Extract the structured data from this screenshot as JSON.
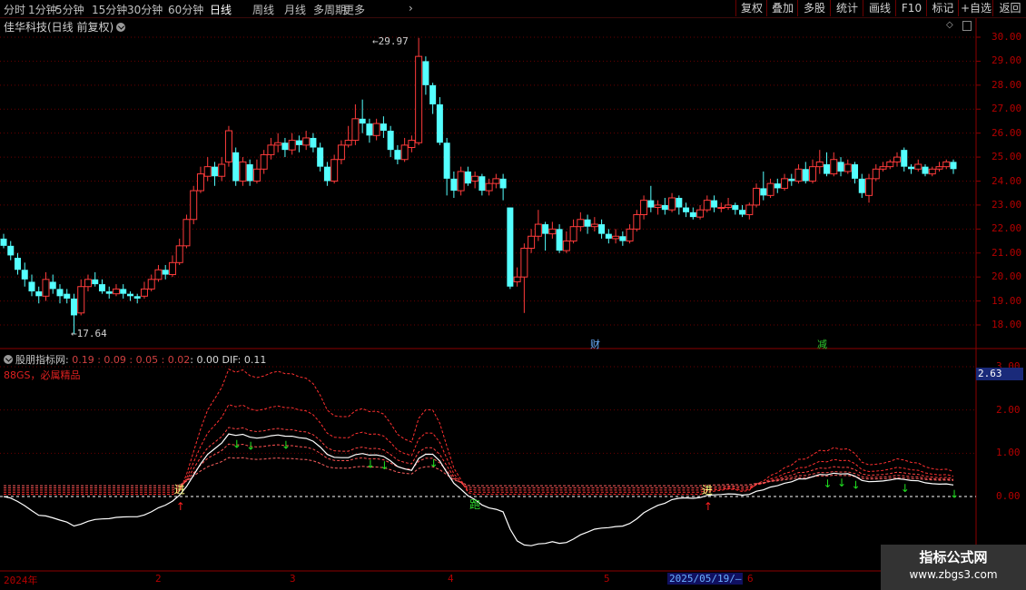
{
  "toolbar": {
    "periods": [
      "分时",
      "1分钟",
      "5分钟",
      "15分钟",
      "30分钟",
      "60分钟",
      "日线",
      "周线",
      "月线",
      "多周期",
      "更多"
    ],
    "active_period": "日线",
    "more_arrow": "›",
    "buttons": [
      "复权",
      "叠加",
      "多股",
      "统计",
      "画线",
      "F10",
      "标记",
      "+自选",
      "返回"
    ]
  },
  "main_chart": {
    "title": "佳华科技(日线 前复权)",
    "high_label": "29.97",
    "low_label": "17.64",
    "markers": {
      "cai": "财",
      "jian": "减"
    },
    "y_ticks": [
      "30.00",
      "29.00",
      "28.00",
      "27.00",
      "26.00",
      "25.00",
      "24.00",
      "23.00",
      "22.00",
      "21.00",
      "20.00",
      "19.00",
      "18.00"
    ]
  },
  "indicator": {
    "name": "股朋指标网",
    "values_prefix": ": ",
    "values": "0.19 : 0.09 : 0.05 : 0.02",
    "extra": ": 0.00  DIF: 0.11",
    "subtitle": "88GS，必属精品",
    "y_ticks": [
      "3.00",
      "2.00",
      "1.00",
      "0.00"
    ],
    "current_value": "2.63",
    "buy_label": "进",
    "run_label": "跑"
  },
  "time_axis": {
    "labels": [
      "2024年",
      "2",
      "3",
      "4",
      "5",
      "6"
    ],
    "cursor_date": "2025/05/19/—"
  },
  "watermark": {
    "line1": "指标公式网",
    "line2": "www.zbgs3.com"
  },
  "colors": {
    "up": "#ff3b3b",
    "down": "#54ffff",
    "grid": "#8b0000",
    "axis_text": "#b40000",
    "white_line": "#ffffff"
  },
  "chart_data": {
    "type": "candlestick",
    "ylim": [
      17.5,
      30.3
    ],
    "candles": [
      [
        21.6,
        21.3,
        21.8,
        21.2
      ],
      [
        21.3,
        20.9,
        21.5,
        20.7
      ],
      [
        20.8,
        20.3,
        21.0,
        20.1
      ],
      [
        20.3,
        19.9,
        20.6,
        19.6
      ],
      [
        19.8,
        19.4,
        20.1,
        19.2
      ],
      [
        19.4,
        19.2,
        19.6,
        18.9
      ],
      [
        19.2,
        19.9,
        20.2,
        19.0
      ],
      [
        19.8,
        19.5,
        20.1,
        19.3
      ],
      [
        19.5,
        19.2,
        19.7,
        18.9
      ],
      [
        19.3,
        19.1,
        19.5,
        18.9
      ],
      [
        19.1,
        18.4,
        19.3,
        17.64
      ],
      [
        18.5,
        19.6,
        19.9,
        18.4
      ],
      [
        19.6,
        19.9,
        20.1,
        19.4
      ],
      [
        19.9,
        19.7,
        20.2,
        19.6
      ],
      [
        19.7,
        19.4,
        19.9,
        19.3
      ],
      [
        19.4,
        19.3,
        19.6,
        19.1
      ],
      [
        19.3,
        19.5,
        19.7,
        19.2
      ],
      [
        19.5,
        19.3,
        19.7,
        19.1
      ],
      [
        19.3,
        19.2,
        19.4,
        19.0
      ],
      [
        19.2,
        19.1,
        19.3,
        18.9
      ],
      [
        19.2,
        19.5,
        19.8,
        19.1
      ],
      [
        19.5,
        19.9,
        20.1,
        19.4
      ],
      [
        19.9,
        20.3,
        20.5,
        19.8
      ],
      [
        20.3,
        20.1,
        20.5,
        19.9
      ],
      [
        20.1,
        20.6,
        20.9,
        20.0
      ],
      [
        20.6,
        21.3,
        21.6,
        20.5
      ],
      [
        21.3,
        22.4,
        22.6,
        21.2
      ],
      [
        22.4,
        23.6,
        23.8,
        22.2
      ],
      [
        23.6,
        24.3,
        24.6,
        23.5
      ],
      [
        24.2,
        24.6,
        25.0,
        24.0
      ],
      [
        24.6,
        24.2,
        24.8,
        23.8
      ],
      [
        24.2,
        24.7,
        25.0,
        24.0
      ],
      [
        24.8,
        26.1,
        26.3,
        24.6
      ],
      [
        25.2,
        24.0,
        25.4,
        23.8
      ],
      [
        24.0,
        24.8,
        25.0,
        23.8
      ],
      [
        24.7,
        24.0,
        24.9,
        23.8
      ],
      [
        24.0,
        24.5,
        24.9,
        23.9
      ],
      [
        24.5,
        25.1,
        25.3,
        24.3
      ],
      [
        25.1,
        25.5,
        25.8,
        24.9
      ],
      [
        25.5,
        25.6,
        26.0,
        25.2
      ],
      [
        25.6,
        25.3,
        25.8,
        25.0
      ],
      [
        25.3,
        25.7,
        26.0,
        25.1
      ],
      [
        25.7,
        25.5,
        25.9,
        25.2
      ],
      [
        25.5,
        25.8,
        26.1,
        25.3
      ],
      [
        25.8,
        25.4,
        26.0,
        25.2
      ],
      [
        25.4,
        24.6,
        25.6,
        24.4
      ],
      [
        24.6,
        24.0,
        24.8,
        23.8
      ],
      [
        24.0,
        24.9,
        25.1,
        23.9
      ],
      [
        24.9,
        25.5,
        25.7,
        24.7
      ],
      [
        25.5,
        25.7,
        26.3,
        25.4
      ],
      [
        25.7,
        26.6,
        27.2,
        25.5
      ],
      [
        26.6,
        26.4,
        27.4,
        26.0
      ],
      [
        26.4,
        25.9,
        26.6,
        25.6
      ],
      [
        25.9,
        26.4,
        26.6,
        25.7
      ],
      [
        26.4,
        26.1,
        26.7,
        25.8
      ],
      [
        26.1,
        25.3,
        26.3,
        25.0
      ],
      [
        25.3,
        24.9,
        25.5,
        24.7
      ],
      [
        24.9,
        25.5,
        25.8,
        24.8
      ],
      [
        25.4,
        25.7,
        25.9,
        25.2
      ],
      [
        25.6,
        29.2,
        29.97,
        25.5
      ],
      [
        29.0,
        28.0,
        29.2,
        27.6
      ],
      [
        28.0,
        27.2,
        28.1,
        26.8
      ],
      [
        27.2,
        25.6,
        27.5,
        25.5
      ],
      [
        25.6,
        24.1,
        25.8,
        23.4
      ],
      [
        24.1,
        23.6,
        24.4,
        23.3
      ],
      [
        23.6,
        24.4,
        24.6,
        23.4
      ],
      [
        24.4,
        23.9,
        24.6,
        23.8
      ],
      [
        24.0,
        24.2,
        24.4,
        23.7
      ],
      [
        24.2,
        23.6,
        24.3,
        23.4
      ],
      [
        23.6,
        23.9,
        24.1,
        23.4
      ],
      [
        23.9,
        24.1,
        24.3,
        23.7
      ],
      [
        24.1,
        23.7,
        24.3,
        23.2
      ],
      [
        22.9,
        19.6,
        22.9,
        19.5
      ],
      [
        19.8,
        20.0,
        20.4,
        19.6
      ],
      [
        20.0,
        21.2,
        21.4,
        18.5
      ],
      [
        21.2,
        21.7,
        22.0,
        21.0
      ],
      [
        21.7,
        22.2,
        22.8,
        21.5
      ],
      [
        22.2,
        21.8,
        22.3,
        21.1
      ],
      [
        21.8,
        22.0,
        22.3,
        21.6
      ],
      [
        22.0,
        21.1,
        22.2,
        21.0
      ],
      [
        21.1,
        21.5,
        21.9,
        21.0
      ],
      [
        21.5,
        22.1,
        22.4,
        21.4
      ],
      [
        22.1,
        22.4,
        22.7,
        21.9
      ],
      [
        22.4,
        22.1,
        22.6,
        21.8
      ],
      [
        22.1,
        22.2,
        22.5,
        21.9
      ],
      [
        22.2,
        21.8,
        22.4,
        21.6
      ],
      [
        21.8,
        21.6,
        22.0,
        21.4
      ],
      [
        21.6,
        21.7,
        22.0,
        21.4
      ],
      [
        21.7,
        21.5,
        21.9,
        21.3
      ],
      [
        21.5,
        22.0,
        22.2,
        21.4
      ],
      [
        22.0,
        22.6,
        22.8,
        21.9
      ],
      [
        22.6,
        23.2,
        23.4,
        22.4
      ],
      [
        23.2,
        22.9,
        23.8,
        22.7
      ],
      [
        22.9,
        23.0,
        23.2,
        22.6
      ],
      [
        23.0,
        22.8,
        23.3,
        22.6
      ],
      [
        22.8,
        23.3,
        23.5,
        22.7
      ],
      [
        23.3,
        22.9,
        23.4,
        22.6
      ],
      [
        22.9,
        22.7,
        23.1,
        22.5
      ],
      [
        22.7,
        22.5,
        22.9,
        22.4
      ],
      [
        22.5,
        22.8,
        23.0,
        22.4
      ],
      [
        22.8,
        23.2,
        23.4,
        22.7
      ],
      [
        23.2,
        22.9,
        23.4,
        22.7
      ],
      [
        22.9,
        22.9,
        23.1,
        22.7
      ],
      [
        22.9,
        23.0,
        23.3,
        22.8
      ],
      [
        23.0,
        22.8,
        23.1,
        22.6
      ],
      [
        22.8,
        22.6,
        23.0,
        22.5
      ],
      [
        22.6,
        23.0,
        23.1,
        22.4
      ],
      [
        23.0,
        23.7,
        23.9,
        22.9
      ],
      [
        23.7,
        23.4,
        24.4,
        23.2
      ],
      [
        23.4,
        23.9,
        24.1,
        23.3
      ],
      [
        23.9,
        23.7,
        24.1,
        23.5
      ],
      [
        23.7,
        24.1,
        24.3,
        23.6
      ],
      [
        24.1,
        24.0,
        24.3,
        23.8
      ],
      [
        24.0,
        24.5,
        24.7,
        23.9
      ],
      [
        24.5,
        24.0,
        24.8,
        23.9
      ],
      [
        24.0,
        24.6,
        24.9,
        23.9
      ],
      [
        24.6,
        24.8,
        25.3,
        24.3
      ],
      [
        24.7,
        24.3,
        25.2,
        24.2
      ],
      [
        24.3,
        24.9,
        25.2,
        24.2
      ],
      [
        24.8,
        24.4,
        25.0,
        24.2
      ],
      [
        24.4,
        24.7,
        24.9,
        24.3
      ],
      [
        24.7,
        24.1,
        24.8,
        23.9
      ],
      [
        24.1,
        23.5,
        24.3,
        23.3
      ],
      [
        23.4,
        24.1,
        24.3,
        23.1
      ],
      [
        24.1,
        24.5,
        24.7,
        24.0
      ],
      [
        24.5,
        24.6,
        24.8,
        24.4
      ],
      [
        24.6,
        24.8,
        24.9,
        24.5
      ],
      [
        24.8,
        25.0,
        25.2,
        24.6
      ],
      [
        25.3,
        24.6,
        25.4,
        24.4
      ],
      [
        24.6,
        24.5,
        24.7,
        24.3
      ],
      [
        24.5,
        24.7,
        24.9,
        24.4
      ],
      [
        24.6,
        24.3,
        24.7,
        24.2
      ],
      [
        24.3,
        24.5,
        24.6,
        24.2
      ],
      [
        24.5,
        24.6,
        24.8,
        24.4
      ],
      [
        24.6,
        24.8,
        24.9,
        24.5
      ],
      [
        24.8,
        24.5,
        24.9,
        24.3
      ]
    ]
  }
}
